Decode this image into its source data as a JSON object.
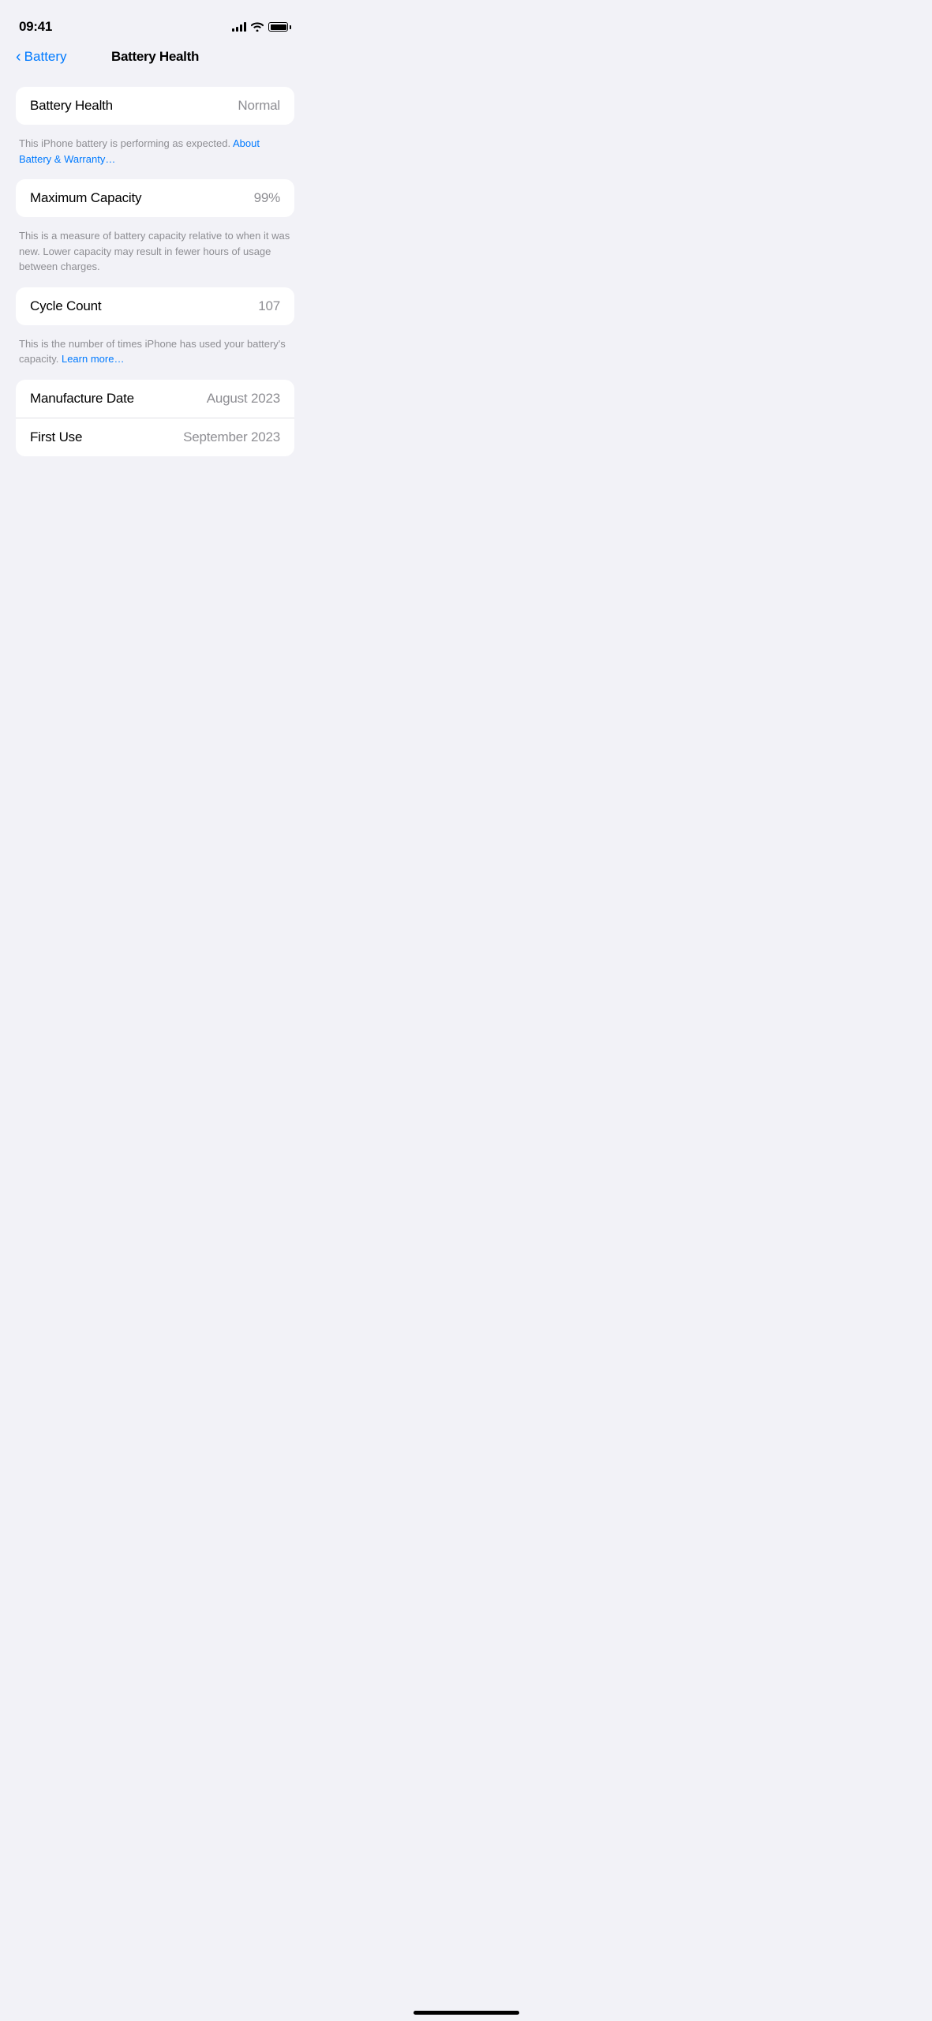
{
  "statusBar": {
    "time": "09:41",
    "battery": "full"
  },
  "nav": {
    "backLabel": "Battery",
    "title": "Battery Health"
  },
  "sections": {
    "batteryHealth": {
      "label": "Battery Health",
      "value": "Normal",
      "description": "This iPhone battery is performing as expected.",
      "linkText": "About Battery & Warranty…"
    },
    "maximumCapacity": {
      "label": "Maximum Capacity",
      "value": "99%",
      "description": "This is a measure of battery capacity relative to when it was new. Lower capacity may result in fewer hours of usage between charges."
    },
    "cycleCount": {
      "label": "Cycle Count",
      "value": "107",
      "description": "This is the number of times iPhone has used your battery's capacity.",
      "linkText": "Learn more…"
    },
    "dates": {
      "manufactureLabel": "Manufacture Date",
      "manufactureValue": "August 2023",
      "firstUseLabel": "First Use",
      "firstUseValue": "September 2023"
    }
  }
}
